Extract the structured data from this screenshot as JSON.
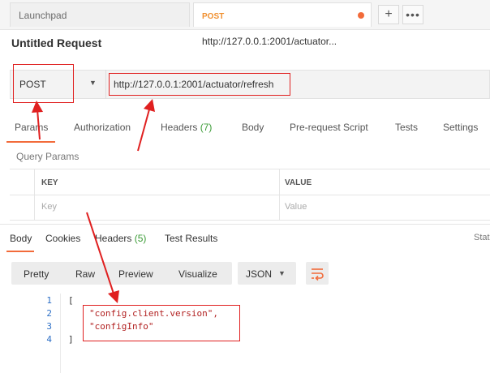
{
  "tabs": [
    {
      "label": "Launchpad"
    },
    {
      "method": "POST",
      "label": "http://127.0.0.1:2001/actuator..."
    }
  ],
  "tab_actions": {
    "new": "+",
    "more": "•••"
  },
  "request": {
    "title": "Untitled Request",
    "method": "POST",
    "url": "http://127.0.0.1:2001/actuator/refresh"
  },
  "request_tabs": [
    {
      "label": "Params",
      "active": true
    },
    {
      "label": "Authorization"
    },
    {
      "label": "Headers",
      "count": "(7)"
    },
    {
      "label": "Body"
    },
    {
      "label": "Pre-request Script"
    },
    {
      "label": "Tests"
    },
    {
      "label": "Settings"
    }
  ],
  "query_params": {
    "label": "Query Params",
    "key_header": "KEY",
    "value_header": "VALUE",
    "key_placeholder": "Key",
    "value_placeholder": "Value"
  },
  "response_tabs": [
    {
      "label": "Body",
      "active": true
    },
    {
      "label": "Cookies"
    },
    {
      "label": "Headers",
      "count": "(5)"
    },
    {
      "label": "Test Results"
    }
  ],
  "status_cut": "Stat",
  "view_modes": [
    "Pretty",
    "Raw",
    "Preview",
    "Visualize"
  ],
  "format": "JSON",
  "code_lines": [
    {
      "n": "1",
      "text": "["
    },
    {
      "n": "2",
      "text": "\"config.client.version\","
    },
    {
      "n": "3",
      "text": "\"configInfo\""
    },
    {
      "n": "4",
      "text": "]"
    }
  ],
  "colors": {
    "accent": "#f26b3a",
    "annotation": "#e02020",
    "count": "#3a9b35",
    "line_numbers": "#2d6fc6"
  },
  "icons": {
    "wrap": "wrap-lines-icon",
    "dropdown": "chevron-down-icon"
  }
}
